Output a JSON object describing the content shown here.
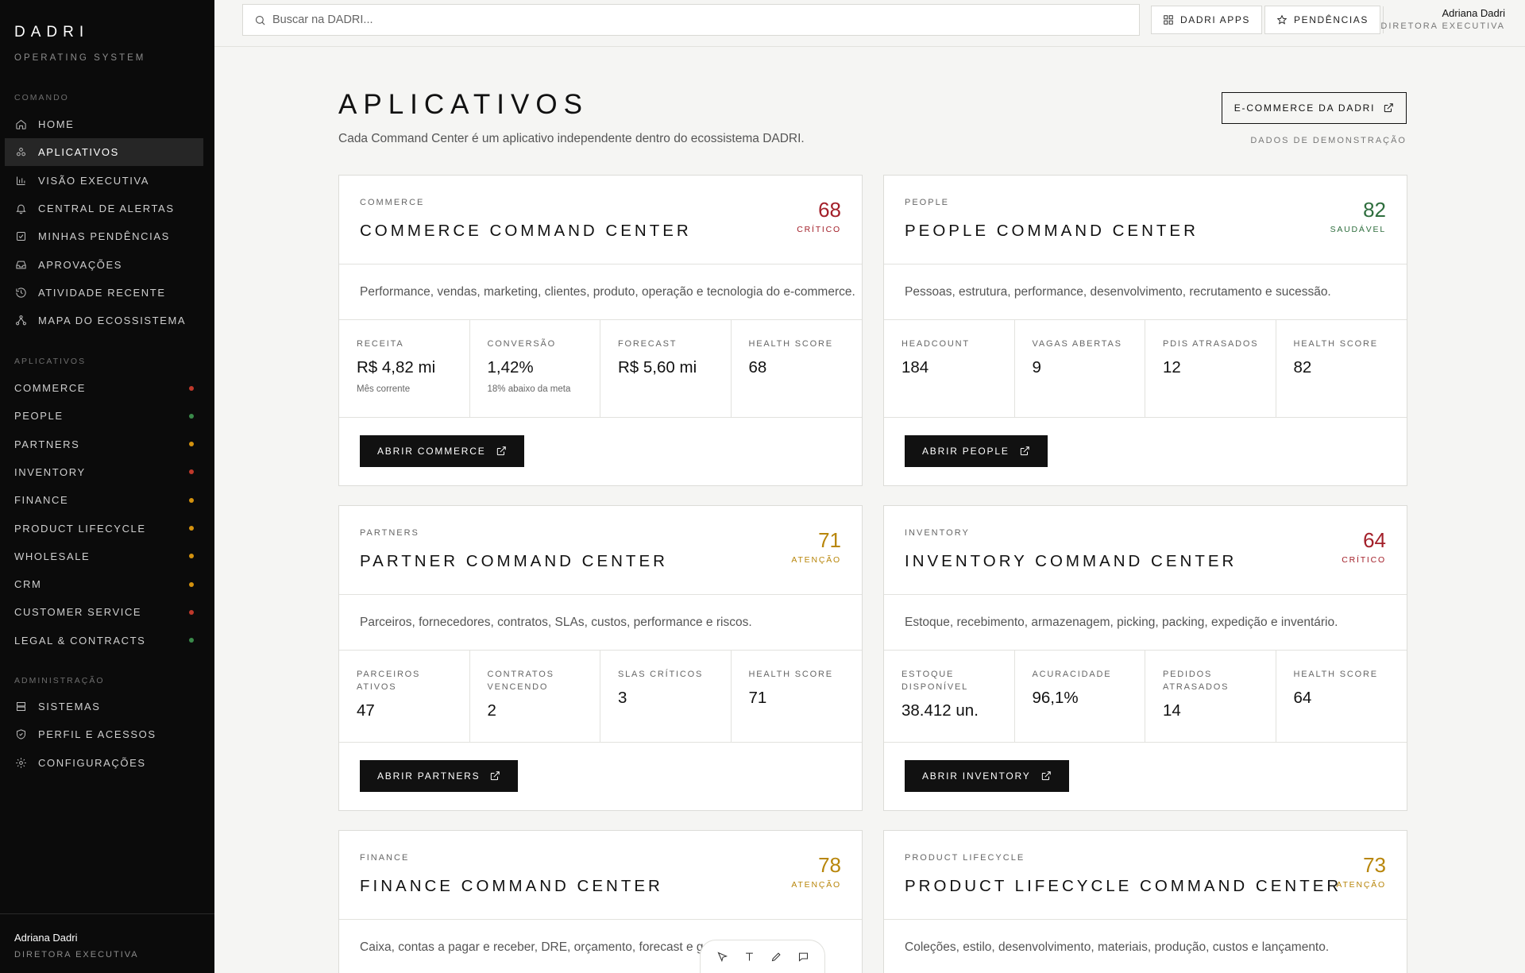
{
  "brand": {
    "name": "DADRI",
    "subtitle": "OPERATING SYSTEM"
  },
  "sidebar": {
    "command_section": "COMANDO",
    "command_items": [
      {
        "label": "HOME",
        "icon": "home-icon"
      },
      {
        "label": "APLICATIVOS",
        "icon": "apps-icon",
        "active": true
      },
      {
        "label": "VISÃO EXECUTIVA",
        "icon": "bar-chart-icon"
      },
      {
        "label": "CENTRAL DE ALERTAS",
        "icon": "bell-icon"
      },
      {
        "label": "MINHAS PENDÊNCIAS",
        "icon": "checkbox-icon"
      },
      {
        "label": "APROVAÇÕES",
        "icon": "inbox-icon"
      },
      {
        "label": "ATIVIDADE RECENTE",
        "icon": "history-icon"
      },
      {
        "label": "MAPA DO ECOSSISTEMA",
        "icon": "network-icon"
      }
    ],
    "apps_section": "APLICATIVOS",
    "app_items": [
      {
        "label": "COMMERCE",
        "status_color": "#c0392b"
      },
      {
        "label": "PEOPLE",
        "status_color": "#3a8a4a"
      },
      {
        "label": "PARTNERS",
        "status_color": "#d4920f"
      },
      {
        "label": "INVENTORY",
        "status_color": "#c0392b"
      },
      {
        "label": "FINANCE",
        "status_color": "#d4920f"
      },
      {
        "label": "PRODUCT LIFECYCLE",
        "status_color": "#d4920f"
      },
      {
        "label": "WHOLESALE",
        "status_color": "#d4920f"
      },
      {
        "label": "CRM",
        "status_color": "#d4920f"
      },
      {
        "label": "CUSTOMER SERVICE",
        "status_color": "#c0392b"
      },
      {
        "label": "LEGAL & CONTRACTS",
        "status_color": "#3a8a4a"
      }
    ],
    "admin_section": "ADMINISTRAÇÃO",
    "admin_items": [
      {
        "label": "SISTEMAS",
        "icon": "server-icon"
      },
      {
        "label": "PERFIL E ACESSOS",
        "icon": "shield-icon"
      },
      {
        "label": "CONFIGURAÇÕES",
        "icon": "gear-icon"
      }
    ],
    "user": {
      "name": "Adriana Dadri",
      "role": "DIRETORA EXECUTIVA"
    }
  },
  "topbar": {
    "search_placeholder": "Buscar na DADRI...",
    "apps_button": "DADRI APPS",
    "pending_button": "PENDÊNCIAS",
    "user": {
      "name": "Adriana Dadri",
      "role": "DIRETORA EXECUTIVA"
    }
  },
  "main": {
    "title": "APLICATIVOS",
    "subtitle": "Cada Command Center é um aplicativo independente dentro do ecossistema DADRI.",
    "ecommerce_button": "E-COMMERCE DA DADRI",
    "demo_label": "DADOS DE DEMONSTRAÇÃO"
  },
  "cards": [
    {
      "category": "COMMERCE",
      "title": "COMMERCE COMMAND CENTER",
      "score": "68",
      "status": "CRÍTICO",
      "status_color": "#a3202a",
      "description": "Performance, vendas, marketing, clientes, produto, operação e tecnologia do e-commerce.",
      "metrics": [
        {
          "label": "RECEITA",
          "value": "R$ 4,82 mi",
          "note": "Mês corrente"
        },
        {
          "label": "CONVERSÃO",
          "value": "1,42%",
          "note": "18% abaixo da meta"
        },
        {
          "label": "FORECAST",
          "value": "R$ 5,60 mi",
          "note": ""
        },
        {
          "label": "HEALTH SCORE",
          "value": "68",
          "note": ""
        }
      ],
      "button": "ABRIR COMMERCE"
    },
    {
      "category": "PEOPLE",
      "title": "PEOPLE COMMAND CENTER",
      "score": "82",
      "status": "SAUDÁVEL",
      "status_color": "#2f6e3e",
      "description": "Pessoas, estrutura, performance, desenvolvimento, recrutamento e sucessão.",
      "metrics": [
        {
          "label": "HEADCOUNT",
          "value": "184",
          "note": ""
        },
        {
          "label": "VAGAS ABERTAS",
          "value": "9",
          "note": ""
        },
        {
          "label": "PDIS ATRASADOS",
          "value": "12",
          "note": ""
        },
        {
          "label": "HEALTH SCORE",
          "value": "82",
          "note": ""
        }
      ],
      "button": "ABRIR PEOPLE"
    },
    {
      "category": "PARTNERS",
      "title": "PARTNER COMMAND CENTER",
      "score": "71",
      "status": "ATENÇÃO",
      "status_color": "#b8860b",
      "description": "Parceiros, fornecedores, contratos, SLAs, custos, performance e riscos.",
      "metrics": [
        {
          "label": "PARCEIROS ATIVOS",
          "value": "47",
          "note": ""
        },
        {
          "label": "CONTRATOS VENCENDO",
          "value": "2",
          "note": ""
        },
        {
          "label": "SLAS CRÍTICOS",
          "value": "3",
          "note": ""
        },
        {
          "label": "HEALTH SCORE",
          "value": "71",
          "note": ""
        }
      ],
      "button": "ABRIR PARTNERS"
    },
    {
      "category": "INVENTORY",
      "title": "INVENTORY COMMAND CENTER",
      "score": "64",
      "status": "CRÍTICO",
      "status_color": "#a3202a",
      "description": "Estoque, recebimento, armazenagem, picking, packing, expedição e inventário.",
      "metrics": [
        {
          "label": "ESTOQUE DISPONÍVEL",
          "value": "38.412 un.",
          "note": ""
        },
        {
          "label": "ACURACIDADE",
          "value": "96,1%",
          "note": ""
        },
        {
          "label": "PEDIDOS ATRASADOS",
          "value": "14",
          "note": ""
        },
        {
          "label": "HEALTH SCORE",
          "value": "64",
          "note": ""
        }
      ],
      "button": "ABRIR INVENTORY"
    },
    {
      "category": "FINANCE",
      "title": "FINANCE COMMAND CENTER",
      "score": "78",
      "status": "ATENÇÃO",
      "status_color": "#b8860b",
      "description": "Caixa, contas a pagar e receber, DRE, orçamento, forecast e gestão",
      "metrics": [],
      "button": ""
    },
    {
      "category": "PRODUCT LIFECYCLE",
      "title": "PRODUCT LIFECYCLE COMMAND CENTER",
      "score": "73",
      "status": "ATENÇÃO",
      "status_color": "#b8860b",
      "description": "Coleções, estilo, desenvolvimento, materiais, produção, custos e lançamento.",
      "metrics": [],
      "button": ""
    }
  ]
}
